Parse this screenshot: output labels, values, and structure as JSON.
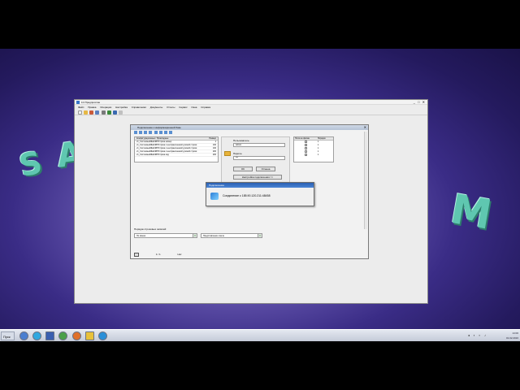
{
  "desktop": {
    "logo_letters": [
      "S",
      "A",
      "M"
    ]
  },
  "app": {
    "title": "1C:Предприятие",
    "menu": [
      "Файл",
      "Правка",
      "Операции",
      "Настройка",
      "Справочники",
      "Документы",
      "Отчеты",
      "Сервис",
      "Окна",
      "Справка"
    ]
  },
  "inner": {
    "title": "Подключение к информационной базе",
    "left_table": {
      "headers": [
        "Конфигурационные / Прикладные",
        "Размер"
      ],
      "rows": [
        [
          "v1_СистемныйФайлВНСтрока.номер",
          "1"
        ],
        [
          "v1_СистемныйФайлВНСтрока.с неограниченной длиной строки",
          "100"
        ],
        [
          "v1_СистемныйФайлВНСтрока.с неограниченной длиной строки",
          "100"
        ],
        [
          "v1_СистемныйФайлВНСтрока.с неограниченной длиной строки",
          "200"
        ],
        [
          "v1_СистемныйФайлВНСтрока.код",
          "200"
        ]
      ]
    },
    "login": {
      "user_label": "Пользователь:",
      "user_value": "Admin",
      "password_label": "Пароль:",
      "password_value": "***",
      "ok_label": "OK",
      "cancel_label": "Отмена",
      "settings_label": "Настройка подключения >>"
    },
    "right_table": {
      "headers": [
        "Поля на форме",
        "Порядок"
      ],
      "rows": [
        [
          "",
          "1"
        ],
        [
          "",
          "1"
        ],
        [
          "",
          "1"
        ],
        [
          "",
          "1"
        ],
        [
          "",
          "1"
        ]
      ]
    },
    "lower_label": "Порядок строковых записей:",
    "combo1": "По имени",
    "combo2": "Представление ключа",
    "pager_text": "1 / 1",
    "pager_extra": "Нет"
  },
  "dialog": {
    "title": "Подключение",
    "message": "Соединение с 185.90.120.211:48458"
  },
  "taskbar": {
    "start_label": "Пуск",
    "time": "14:00",
    "date": "01.02.2016"
  }
}
